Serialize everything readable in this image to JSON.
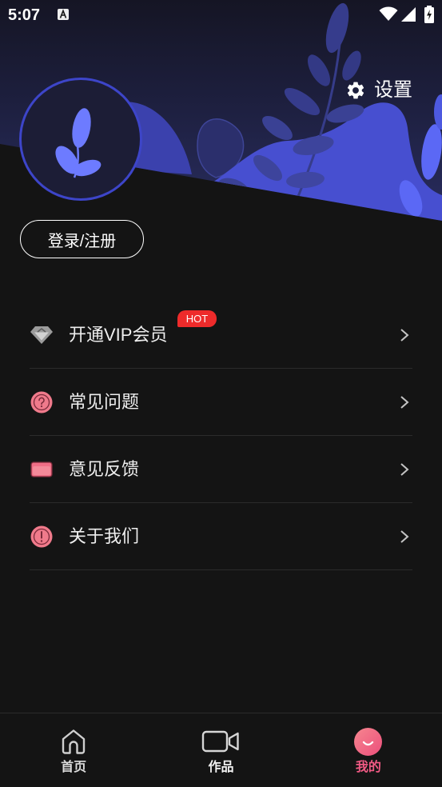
{
  "status_bar": {
    "time": "5:07",
    "icons": [
      "notification-a-icon",
      "wifi-icon",
      "signal-icon",
      "battery-charging-icon"
    ]
  },
  "header": {
    "settings": {
      "icon": "gear-icon",
      "label": "设置"
    },
    "avatar": {
      "icon": "leaf-icon"
    },
    "login_button": {
      "label": "登录/注册"
    }
  },
  "menu": {
    "items": [
      {
        "icon": "diamond-icon",
        "label": "开通VIP会员",
        "badge": "HOT"
      },
      {
        "icon": "question-icon",
        "label": "常见问题"
      },
      {
        "icon": "feedback-card-icon",
        "label": "意见反馈"
      },
      {
        "icon": "info-icon",
        "label": "关于我们"
      }
    ]
  },
  "bottom_nav": {
    "items": [
      {
        "icon": "home-icon",
        "label": "首页",
        "active": false
      },
      {
        "icon": "video-icon",
        "label": "作品",
        "active": false
      },
      {
        "icon": "smile-profile-icon",
        "label": "我的",
        "active": true
      }
    ]
  },
  "colors": {
    "background": "#141414",
    "accent_pink": "#f05a84",
    "hot_badge": "#ee2b2b",
    "header_blue": "#474fd0",
    "avatar_leaf": "#6d7bff"
  }
}
